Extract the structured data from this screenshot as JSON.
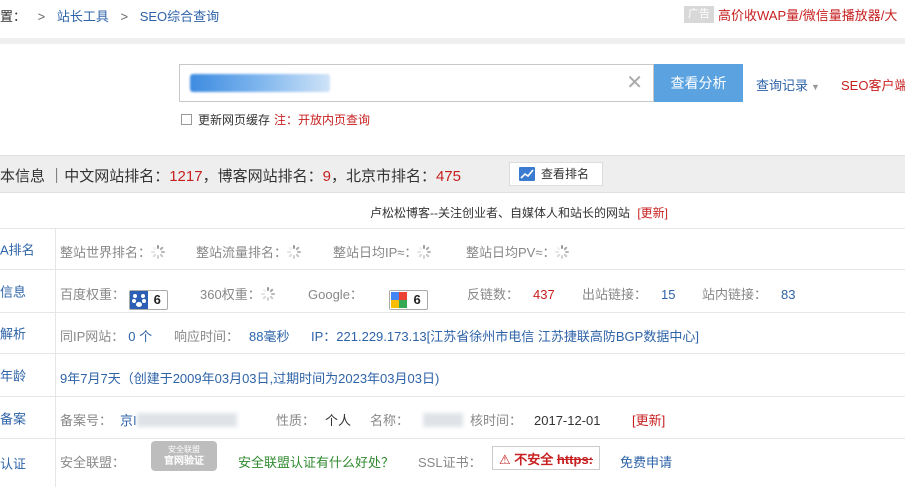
{
  "breadcrumb": {
    "lead": "置：",
    "items": [
      "站长工具",
      "SEO综合查询"
    ]
  },
  "ad": {
    "badge": "广告",
    "text": "高价收WAP量/微信量播放器/大"
  },
  "search": {
    "button": "查看分析",
    "history": "查询记录",
    "seo_client": "SEO客户端",
    "cache_label": "更新网页缓存",
    "cache_note": "注：开放内页查询"
  },
  "infobar": {
    "prefix": "本信息",
    "cn_rank_label": "｜中文网站排名：",
    "cn_rank": "1217",
    "blog_rank_label": "，博客网站排名：",
    "blog_rank": "9",
    "city_rank_label": "，北京市排名：",
    "city_rank": "475",
    "view_rank": "查看排名"
  },
  "site_title": {
    "text": "卢松松博客--关注创业者、自媒体人和站长的网站",
    "update": "[更新]"
  },
  "rows": {
    "alexa": {
      "label": "A排名",
      "world_rank": "整站世界排名：",
      "traffic_rank": "整站流量排名：",
      "daily_ip": "整站日均IP≈：",
      "daily_pv": "整站日均PV≈："
    },
    "seo": {
      "label": "信息",
      "baidu_weight_label": "百度权重：",
      "baidu_weight": "6",
      "weight360_label": "360权重：",
      "google_label": "Google：",
      "google_pr": "6",
      "backlinks_label": "反链数：",
      "backlinks": "437",
      "outbound_label": "出站链接：",
      "outbound": "15",
      "internal_label": "站内链接：",
      "internal": "83"
    },
    "domain": {
      "label": "解析",
      "same_ip_label": "同IP网站：",
      "same_ip": "0 个",
      "response_label": "响应时间：",
      "response": "88毫秒",
      "ip_text": "IP：221.229.173.13[江苏省徐州市电信 江苏捷联高防BGP数据中心]"
    },
    "age": {
      "label": "年龄",
      "text": "9年7月7天（创建于2009年03月03日,过期时间为2023年03月03日)"
    },
    "icp": {
      "label": "备案",
      "number_label": "备案号：",
      "number_prefix": "京I",
      "nature_label": "性质：",
      "nature": "个人",
      "name_label": "名称：",
      "audit_label": "核时间：",
      "audit_date": "2017-12-01",
      "update": "[更新]"
    },
    "cert": {
      "label": "认证",
      "alliance_label": "安全联盟：",
      "seal_top": "安全联盟",
      "seal_main": "官网验证",
      "alliance_link": "安全联盟认证有什么好处？",
      "ssl_label": "SSL证书：",
      "insecure": "⚠ 不安全",
      "https": "https:",
      "free_apply": "免费申请"
    }
  }
}
